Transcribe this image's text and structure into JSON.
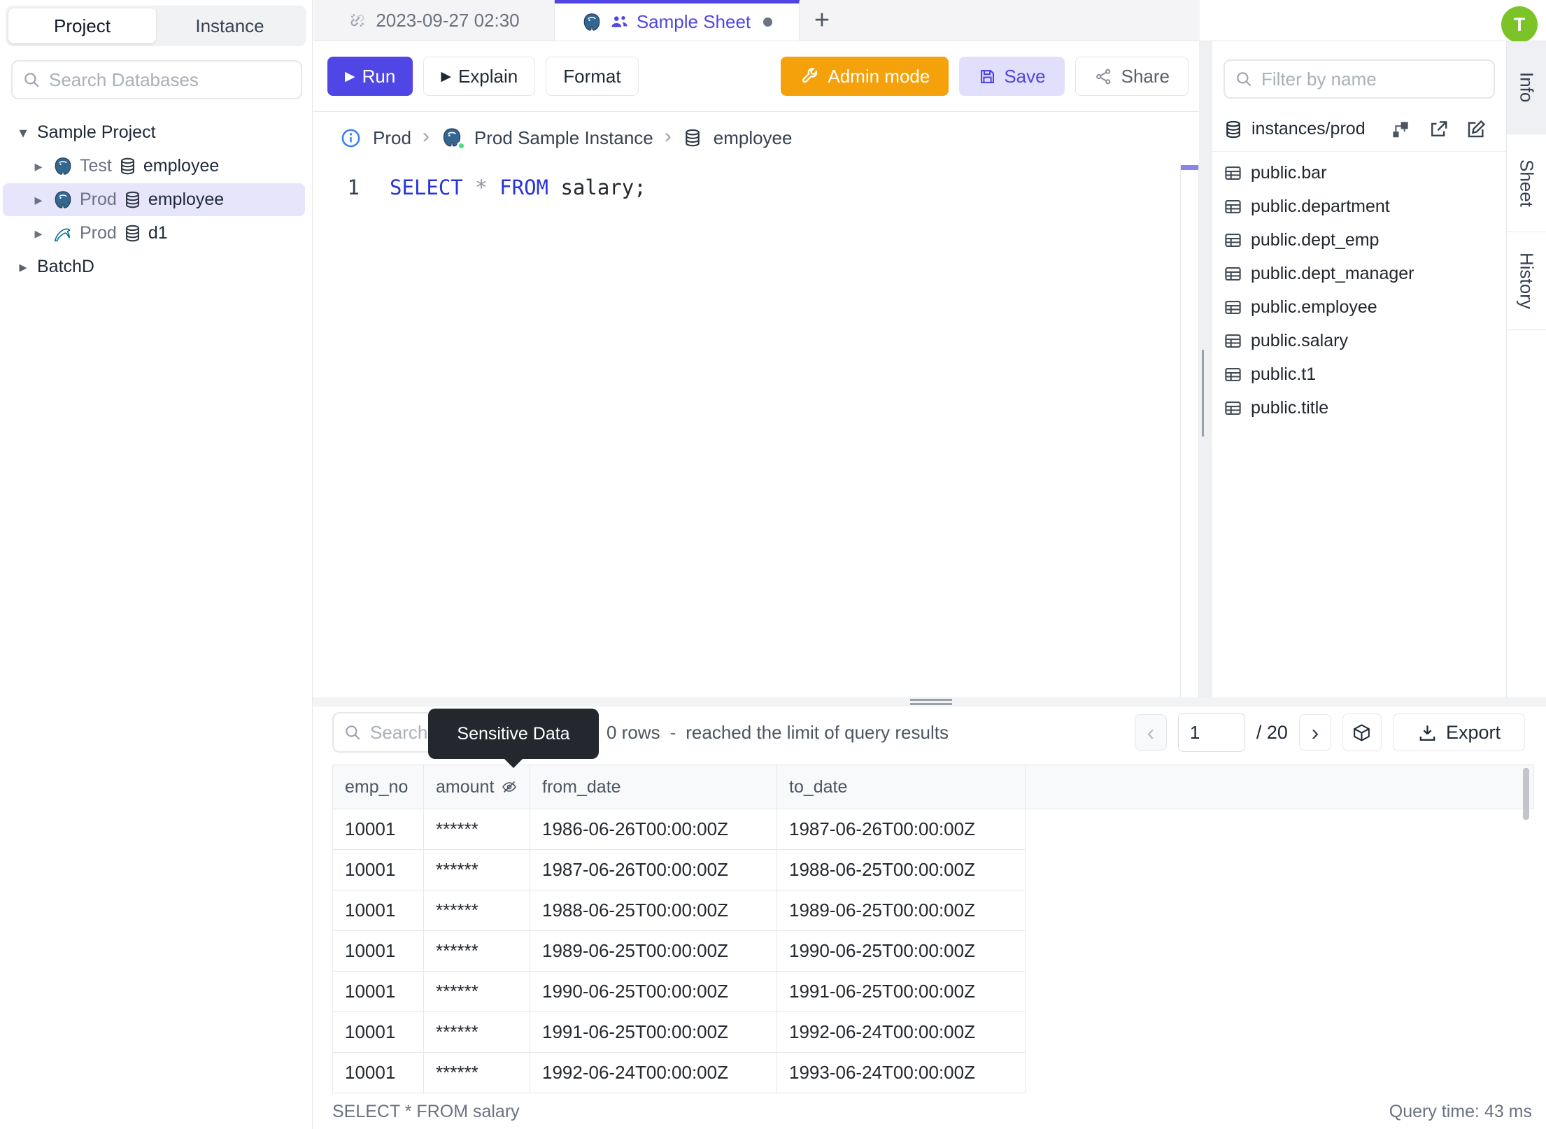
{
  "app": {
    "avatar_initial": "T"
  },
  "sidebar": {
    "tab_project": "Project",
    "tab_instance": "Instance",
    "search_placeholder": "Search Databases",
    "project_label": "Sample Project",
    "batch_label": "BatchD",
    "nodes": [
      {
        "engine": "postgres",
        "env": "Test",
        "db": "employee",
        "selected": false
      },
      {
        "engine": "postgres",
        "env": "Prod",
        "db": "employee",
        "selected": true
      },
      {
        "engine": "mysql",
        "env": "Prod",
        "db": "d1",
        "selected": false
      }
    ]
  },
  "tabs": {
    "connection_tab": "2023-09-27 02:30",
    "sheet_tab": "Sample Sheet",
    "sheet_dirty": true,
    "new_tab": "+"
  },
  "toolbar": {
    "run": "Run",
    "explain": "Explain",
    "format": "Format",
    "admin_mode": "Admin mode",
    "save": "Save",
    "share": "Share",
    "play_glyph": "▶"
  },
  "breadcrumb": {
    "environment": "Prod",
    "instance": "Prod Sample Instance",
    "database": "employee",
    "separator": "›"
  },
  "editor": {
    "line_number": "1",
    "keyword_select": "SELECT",
    "star": "*",
    "keyword_from": "FROM",
    "rest": " salary;"
  },
  "schema_panel": {
    "filter_placeholder": "Filter by name",
    "instance_path": "instances/prod",
    "tables": [
      "public.bar",
      "public.department",
      "public.dept_emp",
      "public.dept_manager",
      "public.employee",
      "public.salary",
      "public.t1",
      "public.title"
    ]
  },
  "side_tabs": {
    "info": "Info",
    "sheet": "Sheet",
    "history": "History"
  },
  "results": {
    "search_placeholder": "Search",
    "tooltip": "Sensitive Data",
    "rows_count": "0 rows",
    "dash": "-",
    "limit_text": "reached the limit of query results",
    "prev_glyph": "‹",
    "next_glyph": "›",
    "page_value": "1",
    "page_total": "/ 20",
    "export_label": "Export",
    "columns": {
      "c1": "emp_no",
      "c2": "amount",
      "c3": "from_date",
      "c4": "to_date"
    },
    "rows": [
      [
        "10001",
        "******",
        "1986-06-26T00:00:00Z",
        "1987-06-26T00:00:00Z"
      ],
      [
        "10001",
        "******",
        "1987-06-26T00:00:00Z",
        "1988-06-25T00:00:00Z"
      ],
      [
        "10001",
        "******",
        "1988-06-25T00:00:00Z",
        "1989-06-25T00:00:00Z"
      ],
      [
        "10001",
        "******",
        "1989-06-25T00:00:00Z",
        "1990-06-25T00:00:00Z"
      ],
      [
        "10001",
        "******",
        "1990-06-25T00:00:00Z",
        "1991-06-25T00:00:00Z"
      ],
      [
        "10001",
        "******",
        "1991-06-25T00:00:00Z",
        "1992-06-24T00:00:00Z"
      ],
      [
        "10001",
        "******",
        "1992-06-24T00:00:00Z",
        "1993-06-24T00:00:00Z"
      ]
    ],
    "status_sql": "SELECT * FROM salary",
    "query_time": "Query time: 43 ms"
  },
  "tree_glyphs": {
    "caret_down": "▾",
    "caret_right": "▸"
  },
  "colors": {
    "accent_indigo": "#4f46e5",
    "admin_orange": "#f5a10b",
    "avatar_green": "#7cc327",
    "postgres_blue": "#336791",
    "mysql_teal": "#00758f",
    "status_green": "#4ade80",
    "selected_row": "#e7e5fb",
    "keyword_blue": "#2733db"
  },
  "icons": {
    "names": [
      "search-icon",
      "unlink-icon",
      "postgres-icon",
      "mysql-icon",
      "database-icon",
      "team-icon",
      "plus-icon",
      "play-icon",
      "wrench-icon",
      "save-icon",
      "share-icon",
      "info-icon",
      "schema-diagram-icon",
      "external-link-icon",
      "edit-icon",
      "table-icon",
      "eye-off-icon",
      "chevron-left-icon",
      "chevron-right-icon",
      "cube-icon",
      "download-icon"
    ]
  }
}
